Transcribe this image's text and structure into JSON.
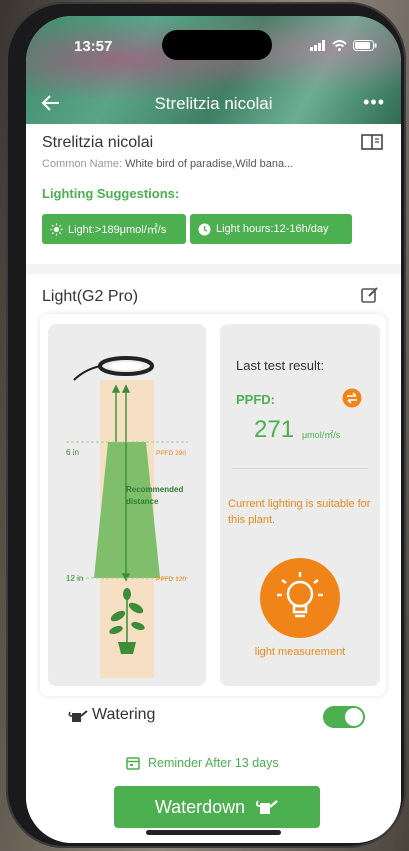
{
  "status": {
    "time": "13:57"
  },
  "nav": {
    "title": "Strelitzia nicolai",
    "more": "•••"
  },
  "plant": {
    "name": "Strelitzia nicolai",
    "common_label": "Common Name:",
    "common_value": "White bird of paradise,Wild bana..."
  },
  "lighting": {
    "title": "Lighting Suggestions:",
    "chip_light": "Light:>189μmol/㎡/s",
    "chip_hours": "Light hours:12-16h/day"
  },
  "device": {
    "title": "Light(G2 Pro)",
    "diagram": {
      "near_distance": "6 in",
      "near_ppfd": "PPFD 290",
      "recommended": "Recommended distance",
      "far_distance": "12 in",
      "far_ppfd": "PPFD 120"
    },
    "result": {
      "last_test": "Last test result:",
      "ppfd_label": "PPFD:",
      "ppfd_value": "271",
      "ppfd_unit": "μmol/㎡/s",
      "suitable": "Current lighting is suitable for this plant.",
      "measure": "light measurement"
    }
  },
  "watering": {
    "label": "Watering",
    "enabled": true,
    "reminder": "Reminder After 13 days",
    "button": "Waterdown"
  },
  "colors": {
    "accent": "#4caf50",
    "orange": "#f08418"
  },
  "icons": [
    "back-arrow-icon",
    "more-icon",
    "book-icon",
    "sun-icon",
    "clock-icon",
    "edit-icon",
    "swap-icon",
    "bulb-icon",
    "watering-can-icon",
    "calendar-icon"
  ]
}
